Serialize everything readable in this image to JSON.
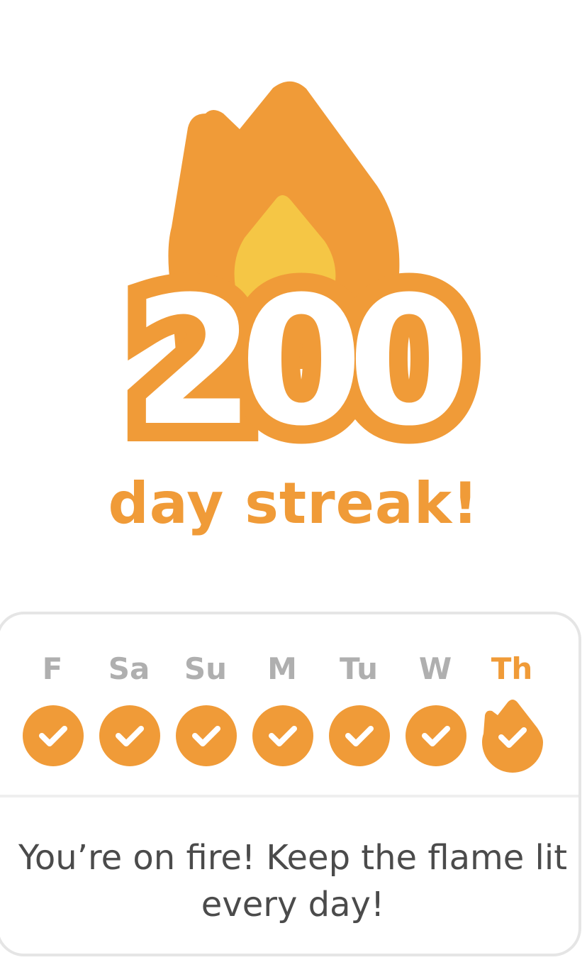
{
  "streak": {
    "count": "200",
    "label": "day streak!"
  },
  "week": {
    "days": [
      {
        "label": "F",
        "done": true,
        "today": false
      },
      {
        "label": "Sa",
        "done": true,
        "today": false
      },
      {
        "label": "Su",
        "done": true,
        "today": false
      },
      {
        "label": "M",
        "done": true,
        "today": false
      },
      {
        "label": "Tu",
        "done": true,
        "today": false
      },
      {
        "label": "W",
        "done": true,
        "today": false
      },
      {
        "label": "Th",
        "done": true,
        "today": true
      }
    ]
  },
  "message": "You’re on fire! Keep the flame lit every day!",
  "colors": {
    "flame_orange": "#F09B38",
    "flame_yellow": "#F5C645",
    "inactive_gray": "#AFAFAF",
    "text_dark": "#4B4B4B",
    "border_gray": "#E5E5E5"
  },
  "icons": {
    "hero": "flame-icon",
    "day_done": "checkmark-circle-icon",
    "day_today": "flame-checkmark-icon"
  }
}
